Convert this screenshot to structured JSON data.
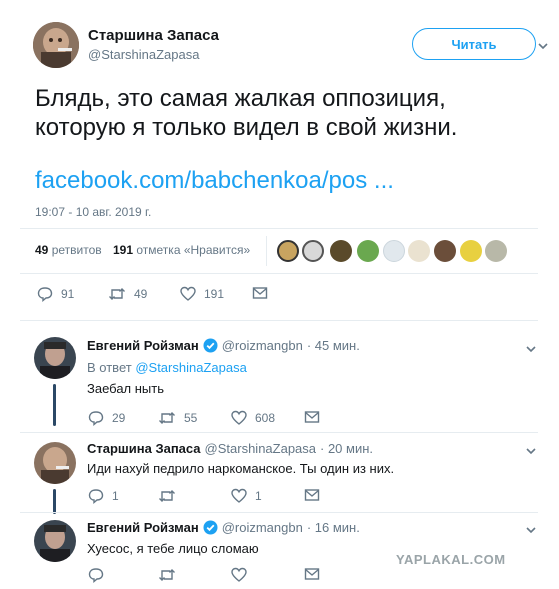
{
  "main_tweet": {
    "author_name": "Старшина Запаса",
    "author_handle": "@StarshinaZapasa",
    "follow_label": "Читать",
    "text_line1": "Блядь, это самая жалкая оппозиция,",
    "text_line2": "которую я только видел в свой жизни.",
    "link_text": "facebook.com/babchenkoa/pos ...",
    "timestamp": "19:07 - 10 авг. 2019 г.",
    "retweets_count": "49",
    "retweets_label": "ретвитов",
    "likes_count": "191",
    "likes_label": "отметка «Нравится»",
    "actions": {
      "replies": "91",
      "retweets": "49",
      "likes": "191"
    }
  },
  "replies": [
    {
      "author_name": "Евгений Ройзман",
      "verified": true,
      "author_handle": "@roizmangbn",
      "time": "· 45 мин.",
      "reply_to_prefix": "В ответ",
      "reply_to_handle": "@StarshinaZapasa",
      "text": "Заебал ныть",
      "actions": {
        "replies": "29",
        "retweets": "55",
        "likes": "608"
      }
    },
    {
      "author_name": "Старшина Запаса",
      "author_handle": "@StarshinaZapasa",
      "time": "· 20 мин.",
      "text": "Иди нахуй педрило наркоманское. Ты один из них.",
      "actions": {
        "replies": "1",
        "retweets": "",
        "likes": "1"
      }
    },
    {
      "author_name": "Евгений Ройзман",
      "verified": true,
      "author_handle": "@roizmangbn",
      "time": "· 16 мин.",
      "text": "Хуесос, я тебе лицо сломаю",
      "actions": {
        "replies": "",
        "retweets": "",
        "likes": ""
      }
    }
  ],
  "watermark": "YAPLAKAL.COM",
  "colors": {
    "accent": "#1da1f2",
    "text": "#14171a",
    "muted": "#657786",
    "thread_line": "#2b4866"
  }
}
